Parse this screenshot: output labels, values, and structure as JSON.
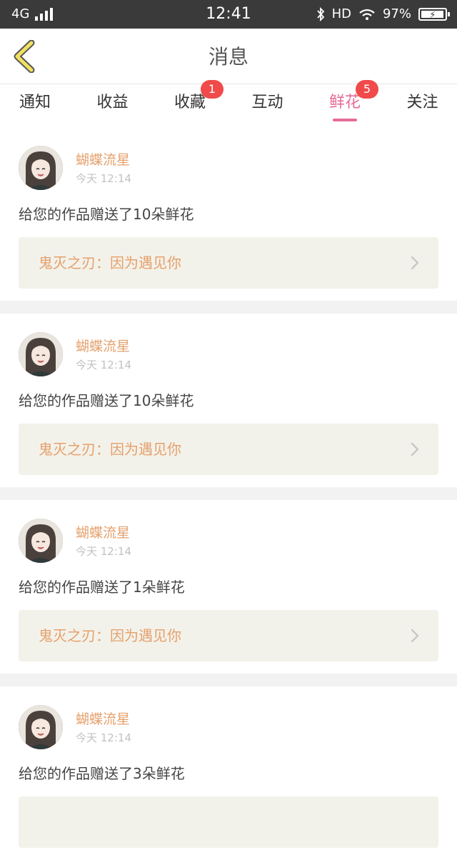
{
  "status_bar": {
    "network": "4G",
    "time": "12:41",
    "hd_label": "HD",
    "battery": "97%",
    "battery_level": 0.97
  },
  "header": {
    "title": "消息"
  },
  "tabs": [
    {
      "label": "通知",
      "badge": ""
    },
    {
      "label": "收益",
      "badge": ""
    },
    {
      "label": "收藏",
      "badge": "1"
    },
    {
      "label": "互动",
      "badge": ""
    },
    {
      "label": "鲜花",
      "badge": "5",
      "active": true
    },
    {
      "label": "关注",
      "badge": ""
    }
  ],
  "colors": {
    "accent_pink": "#e56b97",
    "sender_orange": "#e5a06c",
    "badge_red": "#f04a4a",
    "link_bg": "#f3f2ea"
  },
  "messages": [
    {
      "sender": "蝴蝶流星",
      "time": "今天 12:14",
      "text": "给您的作品赠送了10朵鲜花",
      "work": "鬼灭之刃：因为遇见你"
    },
    {
      "sender": "蝴蝶流星",
      "time": "今天 12:14",
      "text": "给您的作品赠送了10朵鲜花",
      "work": "鬼灭之刃：因为遇见你"
    },
    {
      "sender": "蝴蝶流星",
      "time": "今天 12:14",
      "text": "给您的作品赠送了1朵鲜花",
      "work": "鬼灭之刃：因为遇见你"
    },
    {
      "sender": "蝴蝶流星",
      "time": "今天 12:14",
      "text": "给您的作品赠送了3朵鲜花",
      "work": ""
    }
  ]
}
